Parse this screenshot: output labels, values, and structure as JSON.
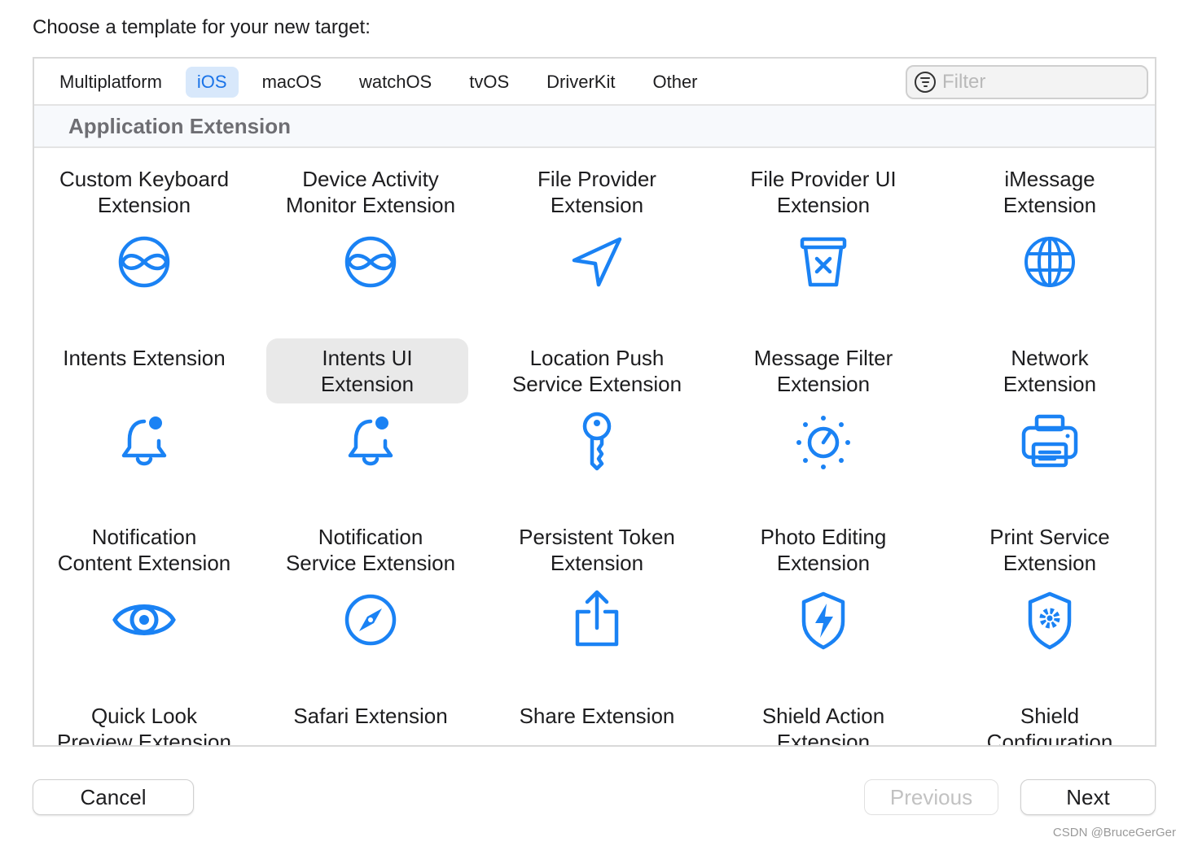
{
  "prompt": "Choose a template for your new target:",
  "tabs": [
    {
      "label": "Multiplatform",
      "active": false
    },
    {
      "label": "iOS",
      "active": true
    },
    {
      "label": "macOS",
      "active": false
    },
    {
      "label": "watchOS",
      "active": false
    },
    {
      "label": "tvOS",
      "active": false
    },
    {
      "label": "DriverKit",
      "active": false
    },
    {
      "label": "Other",
      "active": false
    }
  ],
  "filter": {
    "placeholder": "Filter",
    "value": ""
  },
  "section": {
    "title": "Application Extension"
  },
  "accent_color": "#1a82f4",
  "templates": [
    {
      "label": "Custom Keyboard Extension",
      "icon": "intents-icon"
    },
    {
      "label": "Device Activity Monitor Extension",
      "icon": "intents-icon"
    },
    {
      "label": "File Provider Extension",
      "icon": "location-arrow-icon"
    },
    {
      "label": "File Provider UI Extension",
      "icon": "tray-xmark-icon"
    },
    {
      "label": "iMessage Extension",
      "icon": "globe-icon"
    },
    {
      "label": "Intents Extension",
      "icon": "bell-badge-icon"
    },
    {
      "label": "Intents UI Extension",
      "icon": "bell-badge-icon",
      "selected": true
    },
    {
      "label": "Location Push Service Extension",
      "icon": "key-icon"
    },
    {
      "label": "Message Filter Extension",
      "icon": "photo-editing-dial-icon"
    },
    {
      "label": "Network Extension",
      "icon": "printer-icon"
    },
    {
      "label": "Notification Content Extension",
      "icon": "eye-icon"
    },
    {
      "label": "Notification Service Extension",
      "icon": "compass-icon"
    },
    {
      "label": "Persistent Token Extension",
      "icon": "share-icon"
    },
    {
      "label": "Photo Editing Extension",
      "icon": "shield-bolt-icon"
    },
    {
      "label": "Print Service Extension",
      "icon": "shield-gear-icon"
    },
    {
      "label": "Quick Look Preview Extension",
      "icon": ""
    },
    {
      "label": "Safari Extension",
      "icon": ""
    },
    {
      "label": "Share Extension",
      "icon": ""
    },
    {
      "label": "Shield Action Extension",
      "icon": ""
    },
    {
      "label": "Shield Configuration",
      "icon": ""
    }
  ],
  "buttons": {
    "cancel": "Cancel",
    "previous": "Previous",
    "next": "Next"
  },
  "watermark": "CSDN @BruceGerGer"
}
